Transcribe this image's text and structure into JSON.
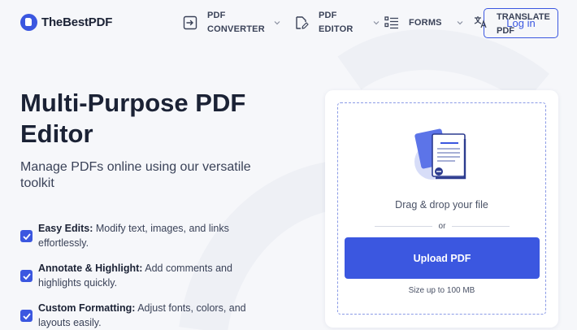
{
  "brand": {
    "name": "TheBestPDF",
    "accent": "#3b57e0"
  },
  "nav": {
    "items": [
      {
        "line1": "PDF",
        "line2": "CONVERTER",
        "icon": "arrow-in-box-icon"
      },
      {
        "line1": "PDF",
        "line2": "EDITOR",
        "icon": "edit-document-icon"
      },
      {
        "line1": "FORMS",
        "line2": "",
        "icon": "list-icon"
      }
    ],
    "translate": {
      "line1": "TRANSLATE",
      "line2": "PDF",
      "icon": "translate-icon"
    },
    "login_label": "Log in"
  },
  "hero": {
    "title": "Multi-Purpose PDF Editor",
    "subtitle": "Manage PDFs online using our versatile toolkit"
  },
  "features": [
    {
      "title": "Easy Edits:",
      "text": " Modify text, images, and links effortlessly."
    },
    {
      "title": "Annotate & Highlight:",
      "text": " Add comments and highlights quickly."
    },
    {
      "title": "Custom Formatting:",
      "text": " Adjust fonts, colors, and layouts easily."
    }
  ],
  "upload": {
    "drag_text": "Drag & drop your file",
    "or_text": "or",
    "button_label": "Upload PDF",
    "size_limit": "Size up to 100 MB"
  }
}
